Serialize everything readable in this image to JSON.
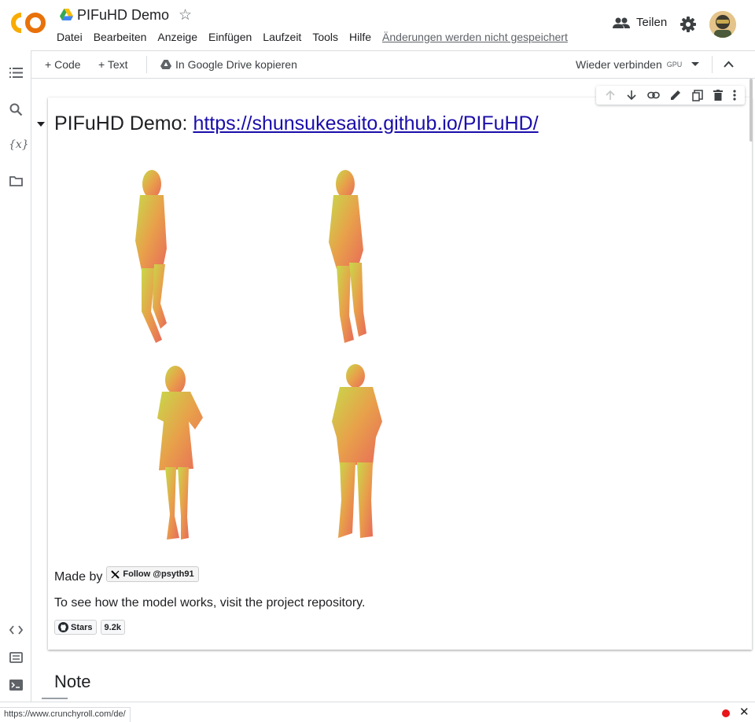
{
  "app": {
    "title": "PIFuHD Demo",
    "menu": [
      "Datei",
      "Bearbeiten",
      "Anzeige",
      "Einfügen",
      "Laufzeit",
      "Tools",
      "Hilfe"
    ],
    "unsaved": "Änderungen werden nicht gespeichert",
    "share_label": "Teilen"
  },
  "toolbar": {
    "code_label": "Code",
    "text_label": "Text",
    "copy_drive_label": "In Google Drive kopieren",
    "reconnect_label": "Wieder verbinden",
    "runtime_badge": "GPU"
  },
  "cell": {
    "heading_prefix": "PIFuHD Demo: ",
    "heading_link": "https://shunsukesaito.github.io/PIFuHD/",
    "made_by": "Made by",
    "follow_label": "Follow @psyth91",
    "visit_text": "To see how the model works, visit the project repository.",
    "stars_label": "Stars",
    "stars_count": "9.2k"
  },
  "next_cell": {
    "heading": "Note"
  },
  "statusbar": {
    "url": "https://www.crunchyroll.com/de/"
  },
  "colors": {
    "logo_orange": "#F9AB00",
    "logo_dark": "#E8710A",
    "link": "#1a0dab",
    "record": "#e8151a"
  },
  "icons": [
    "toc-icon",
    "search-icon",
    "variables-icon",
    "folder-icon",
    "code-snippets-icon",
    "command-palette-icon",
    "terminal-icon",
    "people-icon",
    "gear-icon",
    "star-icon",
    "drive-icon"
  ]
}
